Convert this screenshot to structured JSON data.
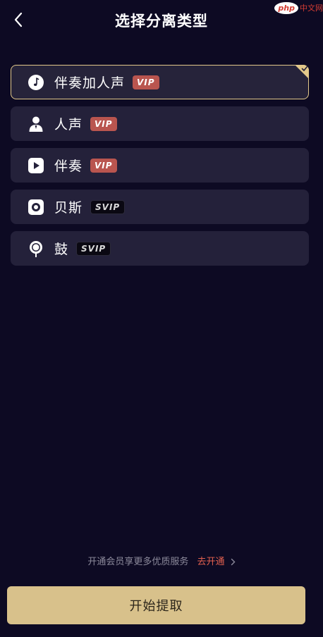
{
  "header": {
    "title": "选择分离类型",
    "back_icon": "chevron-left-icon",
    "watermark_badge": "php",
    "watermark_text": "中文网"
  },
  "options": [
    {
      "label": "伴奏加人声",
      "badge": "VIP",
      "badge_type": "vip",
      "icon": "music-note-icon",
      "selected": true
    },
    {
      "label": "人声",
      "badge": "VIP",
      "badge_type": "vip",
      "icon": "person-icon",
      "selected": false
    },
    {
      "label": "伴奏",
      "badge": "VIP",
      "badge_type": "vip",
      "icon": "play-icon",
      "selected": false
    },
    {
      "label": "贝斯",
      "badge": "SVIP",
      "badge_type": "svip",
      "icon": "speaker-icon",
      "selected": false
    },
    {
      "label": "鼓",
      "badge": "SVIP",
      "badge_type": "svip",
      "icon": "drum-icon",
      "selected": false
    }
  ],
  "promo": {
    "text": "开通会员享更多优质服务",
    "link": "去开通"
  },
  "start_button": "开始提取",
  "colors": {
    "background": "#0d0a23",
    "card": "#24213a",
    "accent_gold": "#e2c88a",
    "vip_badge": "#b9554f",
    "link_red": "#e2604f",
    "button": "#d8c18b"
  }
}
